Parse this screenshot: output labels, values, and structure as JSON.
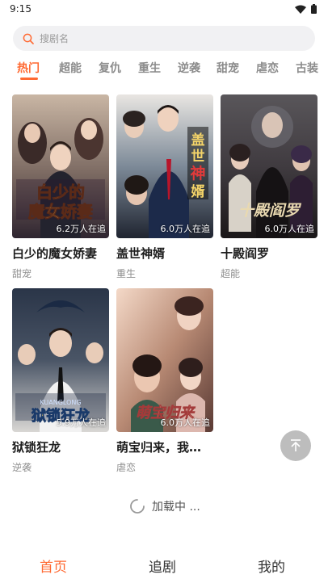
{
  "status": {
    "time": "9:15",
    "wifi_icon": "wifi-icon",
    "battery_icon": "battery-icon"
  },
  "search": {
    "placeholder": "搜剧名",
    "icon": "search-icon"
  },
  "tabs": [
    {
      "label": "热门",
      "active": true
    },
    {
      "label": "超能"
    },
    {
      "label": "复仇"
    },
    {
      "label": "重生"
    },
    {
      "label": "逆袭"
    },
    {
      "label": "甜宠"
    },
    {
      "label": "虐恋"
    },
    {
      "label": "古装"
    }
  ],
  "dramas": [
    {
      "title": "白少的魔女娇妻",
      "tag": "甜宠",
      "followers": "6.2万人在追",
      "poster_text": "白少的魔女娇妻"
    },
    {
      "title": "盖世神婿",
      "tag": "重生",
      "followers": "6.0万人在追",
      "poster_text": "盖世神婿"
    },
    {
      "title": "十殿阎罗",
      "tag": "超能",
      "followers": "6.0万人在追",
      "poster_text": "十殿阎罗"
    },
    {
      "title": "狱锁狂龙",
      "tag": "逆袭",
      "followers": "5.9万人在追",
      "poster_text": "狱锁狂龙"
    },
    {
      "title": "萌宝归来，我…",
      "tag": "虐恋",
      "followers": "6.0万人在追",
      "poster_text": "萌宝归来"
    }
  ],
  "loading": {
    "text": "加载中 ..."
  },
  "back_to_top_icon": "arrow-up-icon",
  "bottom_nav": [
    {
      "label": "首页",
      "active": true
    },
    {
      "label": "追剧"
    },
    {
      "label": "我的"
    }
  ],
  "colors": {
    "accent": "#ff6a33",
    "tag": "#8e8e8e",
    "search_bg": "#f1f1f3"
  }
}
